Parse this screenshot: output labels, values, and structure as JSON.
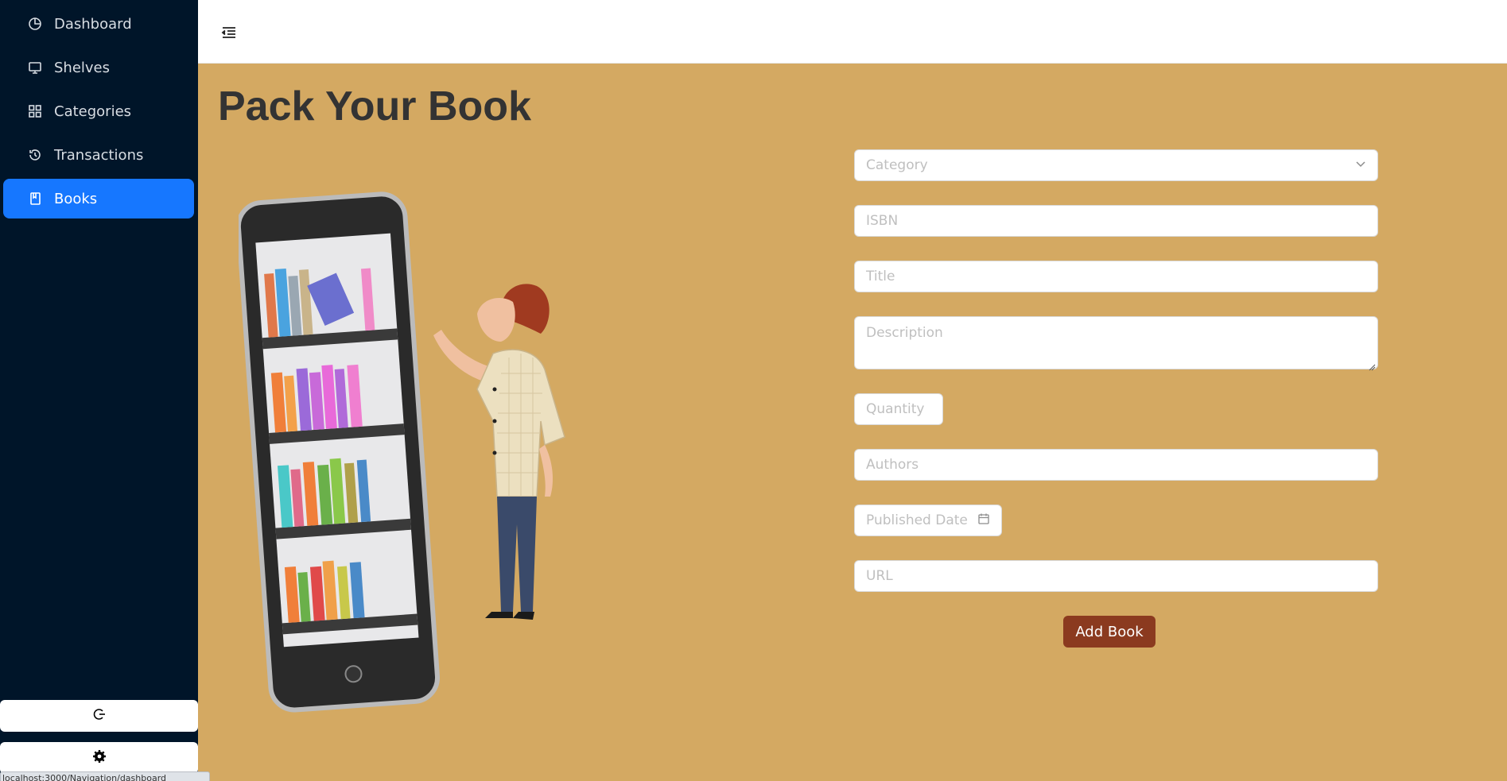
{
  "sidebar": {
    "items": [
      {
        "label": "Dashboard",
        "icon": "pie-chart-icon"
      },
      {
        "label": "Shelves",
        "icon": "desktop-icon"
      },
      {
        "label": "Categories",
        "icon": "appstore-icon"
      },
      {
        "label": "Transactions",
        "icon": "history-icon"
      },
      {
        "label": "Books",
        "icon": "book-icon",
        "active": true
      }
    ],
    "bottom_buttons": [
      {
        "icon": "logout-icon"
      },
      {
        "icon": "settings-icon"
      }
    ],
    "status_url": "localhost:3000/Navigation/dashboard"
  },
  "header": {
    "toggle_icon": "menu-fold-icon"
  },
  "main": {
    "title": "Pack Your Book",
    "form": {
      "category_placeholder": "Category",
      "isbn_placeholder": "ISBN",
      "title_placeholder": "Title",
      "description_placeholder": "Description",
      "quantity_placeholder": "Quantity",
      "authors_placeholder": "Authors",
      "published_date_placeholder": "Published Date",
      "url_placeholder": "URL",
      "submit_label": "Add Book"
    }
  },
  "colors": {
    "sidebar_bg": "#001529",
    "active_item": "#1677ff",
    "page_bg": "#d4a962",
    "button_bg": "#8b3a1f",
    "title_color": "#333333"
  }
}
